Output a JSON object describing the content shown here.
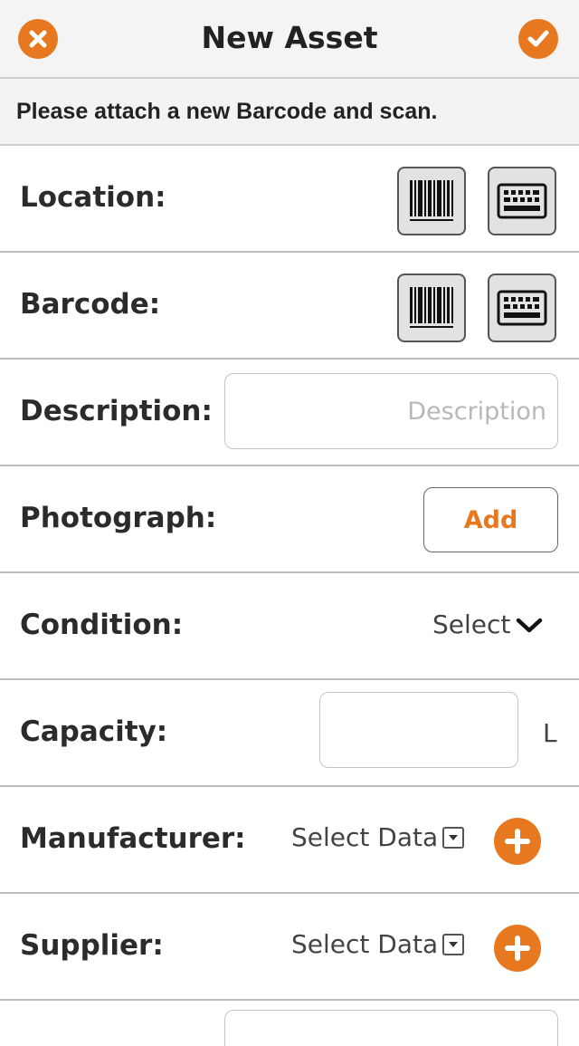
{
  "header": {
    "title": "New Asset",
    "cancel_icon": "close-circle-icon",
    "confirm_icon": "check-circle-icon"
  },
  "notice": {
    "text": "Please attach a new Barcode and scan."
  },
  "colors": {
    "accent": "#e8781f",
    "text": "#2b2b2b",
    "divider": "#bdbdbd"
  },
  "fields": {
    "location": {
      "label": "Location:"
    },
    "barcode": {
      "label": "Barcode:"
    },
    "description": {
      "label": "Description:",
      "placeholder": "Description",
      "value": ""
    },
    "photograph": {
      "label": "Photograph:",
      "button": "Add"
    },
    "condition": {
      "label": "Condition:",
      "value": "Select"
    },
    "capacity": {
      "label": "Capacity:",
      "value": "",
      "unit": "L"
    },
    "manufacturer": {
      "label": "Manufacturer:",
      "value": "Select Data"
    },
    "supplier": {
      "label": "Supplier:",
      "value": "Select Data"
    }
  }
}
